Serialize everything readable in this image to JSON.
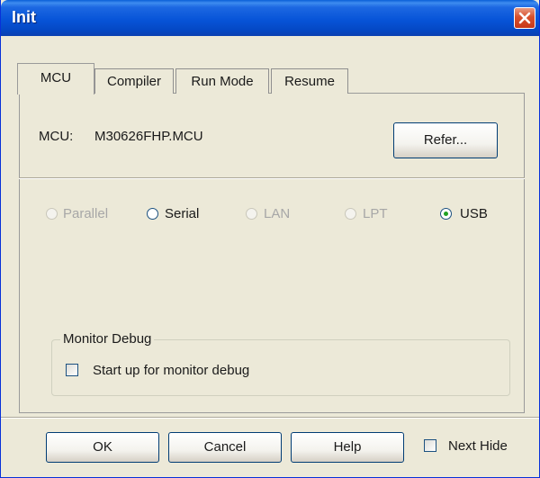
{
  "window": {
    "title": "Init",
    "close_icon": "close-icon"
  },
  "tabs": [
    {
      "label": "MCU",
      "active": true
    },
    {
      "label": "Compiler",
      "active": false
    },
    {
      "label": "Run Mode",
      "active": false
    },
    {
      "label": "Resume",
      "active": false
    }
  ],
  "mcu": {
    "label": "MCU:",
    "value": "M30626FHP.MCU",
    "refer_button": "Refer..."
  },
  "connection": {
    "options": [
      {
        "label": "Parallel",
        "enabled": false,
        "selected": false
      },
      {
        "label": "Serial",
        "enabled": true,
        "selected": false
      },
      {
        "label": "LAN",
        "enabled": false,
        "selected": false
      },
      {
        "label": "LPT",
        "enabled": false,
        "selected": false
      },
      {
        "label": "USB",
        "enabled": true,
        "selected": true
      }
    ]
  },
  "monitor_debug": {
    "group_title": "Monitor Debug",
    "checkbox_label": "Start up for monitor debug",
    "checked": false
  },
  "footer": {
    "ok": "OK",
    "cancel": "Cancel",
    "help": "Help",
    "next_hide": "Next Hide",
    "next_hide_checked": false
  },
  "colors": {
    "title_bar": "#0754d8",
    "dialog_bg": "#ece9d8",
    "close_button": "#d8502c",
    "radio_selected_dot": "#21a121",
    "disabled_text": "#a7a7a7"
  }
}
